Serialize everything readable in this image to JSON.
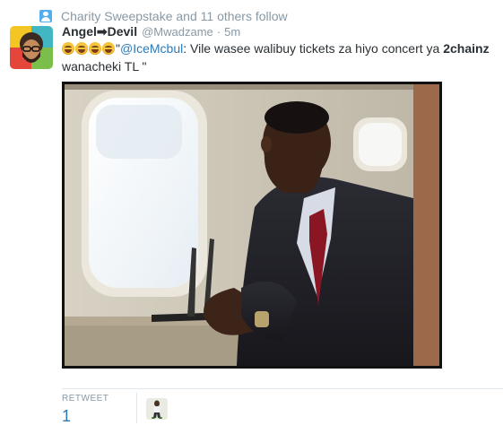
{
  "context": {
    "icon": "follow-icon",
    "text": "Charity Sweepstake and 11 others follow"
  },
  "tweet": {
    "fullname": "Angel➡Devil",
    "username": "@Mwadzame",
    "separator": "·",
    "time": "5m",
    "emoji_count": 4,
    "text_quote_open": "\"",
    "mention": "@IceMcbul",
    "text_after_mention": ": Vile wasee walibuy tickets za hiyo concert ya ",
    "text_strong": "2chainz",
    "text_tail": " wanacheki TL \""
  },
  "stats": {
    "retweet_label": "RETWEET",
    "retweet_count": "1"
  },
  "colors": {
    "link": "#2b7bb9",
    "muted": "#8899a6",
    "divider": "#e1e8ed"
  }
}
